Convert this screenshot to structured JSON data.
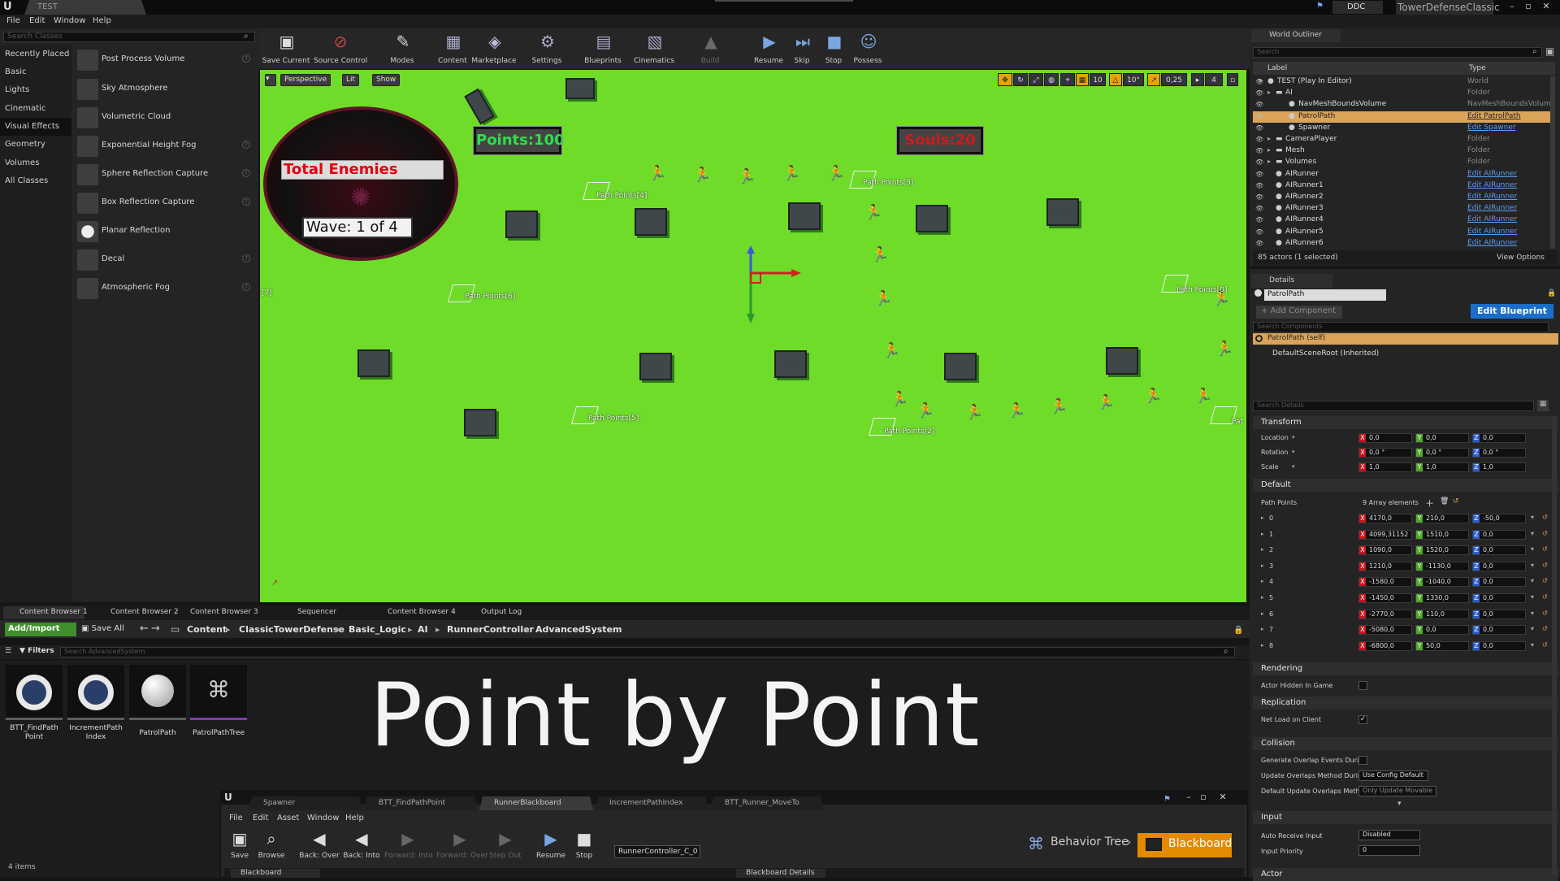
{
  "window": {
    "project_tab": "TEST",
    "ddc": "DDC",
    "project_name": "TowerDefenseClassic"
  },
  "menu": [
    "File",
    "Edit",
    "Window",
    "Help"
  ],
  "place": {
    "search_placeholder": "Search Classes",
    "categories": [
      "Recently Placed",
      "Basic",
      "Lights",
      "Cinematic",
      "Visual Effects",
      "Geometry",
      "Volumes",
      "All Classes"
    ],
    "selected_category": "Visual Effects",
    "items": [
      "Post Process Volume",
      "Sky Atmosphere",
      "Volumetric Cloud",
      "Exponential Height Fog",
      "Sphere Reflection Capture",
      "Box Reflection Capture",
      "Planar Reflection",
      "Decal",
      "Atmospheric Fog"
    ]
  },
  "toolbar": {
    "buttons": [
      "Save Current",
      "Source Control",
      "Modes",
      "Content",
      "Marketplace",
      "Settings",
      "Blueprints",
      "Cinematics",
      "Build",
      "Resume",
      "Skip",
      "Stop",
      "Possess"
    ],
    "disabled": [
      "Build"
    ]
  },
  "viewport": {
    "buttons": [
      "Perspective",
      "Lit",
      "Show"
    ],
    "readouts": [
      "10",
      "10°",
      "0,25",
      "4"
    ],
    "hud": {
      "total_enemies": "Total Enemies",
      "wave": "Wave: 1 of 4",
      "points": "Points:100",
      "souls": "Souls:20"
    },
    "path_labels": [
      "Path Points[4]",
      "Path Points[3]",
      "Path Points[6]",
      "Path Points[0]",
      "Path Points[5]",
      "Path Points[2]",
      "[7]",
      "Pat"
    ],
    "accent": "#6fdc2a"
  },
  "outliner": {
    "tab": "World Outliner",
    "search_placeholder": "Search",
    "col_label": "Label",
    "col_type": "Type",
    "rows": [
      {
        "label": "TEST (Play In Editor)",
        "type": "World",
        "link": false
      },
      {
        "label": "AI",
        "type": "Folder",
        "link": false
      },
      {
        "label": "NavMeshBoundsVolume",
        "type": "NavMeshBoundsVolume",
        "link": false
      },
      {
        "label": "PatrolPath",
        "type": "Edit PatrolPath",
        "link": true
      },
      {
        "label": "Spawner",
        "type": "Edit Spawner",
        "link": true
      },
      {
        "label": "CameraPlayer",
        "type": "Folder",
        "link": false
      },
      {
        "label": "Mesh",
        "type": "Folder",
        "link": false
      },
      {
        "label": "Volumes",
        "type": "Folder",
        "link": false
      },
      {
        "label": "AIRunner",
        "type": "Edit AIRunner",
        "link": true
      },
      {
        "label": "AIRunner1",
        "type": "Edit AIRunner",
        "link": true
      },
      {
        "label": "AIRunner2",
        "type": "Edit AIRunner",
        "link": true
      },
      {
        "label": "AIRunner3",
        "type": "Edit AIRunner",
        "link": true
      },
      {
        "label": "AIRunner4",
        "type": "Edit AIRunner",
        "link": true
      },
      {
        "label": "AIRunner5",
        "type": "Edit AIRunner",
        "link": true
      },
      {
        "label": "AIRunner6",
        "type": "Edit AIRunner",
        "link": true
      }
    ],
    "selected": "PatrolPath",
    "footer": "85 actors (1 selected)",
    "view_options": "View Options"
  },
  "details": {
    "tab": "Details",
    "name": "PatrolPath",
    "add_component": "+ Add Component",
    "edit_blueprint": "Edit Blueprint",
    "search_components": "Search Components",
    "self_row": "PatrolPath (self)",
    "root_row": "DefaultSceneRoot (Inherited)",
    "search_details": "Search Details",
    "sections": [
      "Transform",
      "Default",
      "Rendering",
      "Replication",
      "Collision",
      "Input",
      "Actor"
    ],
    "transform": [
      {
        "label": "Location",
        "x": "0,0",
        "y": "0,0",
        "z": "0,0"
      },
      {
        "label": "Rotation",
        "x": "0,0 °",
        "y": "0,0 °",
        "z": "0,0 °"
      },
      {
        "label": "Scale",
        "x": "1,0",
        "y": "1,0",
        "z": "1,0"
      }
    ],
    "path_points_label": "Path Points",
    "path_points_count": "9 Array elements",
    "path_points": [
      {
        "i": "0",
        "x": "4170,0",
        "y": "210,0",
        "z": "-50,0"
      },
      {
        "i": "1",
        "x": "4099,31152",
        "y": "1510,0",
        "z": "0,0"
      },
      {
        "i": "2",
        "x": "1090,0",
        "y": "1520,0",
        "z": "0,0"
      },
      {
        "i": "3",
        "x": "1210,0",
        "y": "-1130,0",
        "z": "0,0"
      },
      {
        "i": "4",
        "x": "-1580,0",
        "y": "-1040,0",
        "z": "0,0"
      },
      {
        "i": "5",
        "x": "-1450,0",
        "y": "1330,0",
        "z": "0,0"
      },
      {
        "i": "6",
        "x": "-2770,0",
        "y": "110,0",
        "z": "0,0"
      },
      {
        "i": "7",
        "x": "-5080,0",
        "y": "0,0",
        "z": "0,0"
      },
      {
        "i": "8",
        "x": "-6800,0",
        "y": "50,0",
        "z": "0,0"
      }
    ],
    "rendering": {
      "label": "Actor Hidden In Game"
    },
    "replication": {
      "label": "Net Load on Client"
    },
    "collision": [
      {
        "label": "Generate Overlap Events During"
      },
      {
        "label": "Update Overlaps Method During",
        "value": "Use Config Default"
      },
      {
        "label": "Default Update Overlaps Metho",
        "value": "Only Update Movable"
      }
    ],
    "input": [
      {
        "label": "Auto Receive Input",
        "value": "Disabled"
      },
      {
        "label": "Input Priority",
        "value": "0"
      }
    ]
  },
  "content_browser": {
    "tabs": [
      "Content Browser 1",
      "Content Browser 2",
      "Content Browser 3",
      "Sequencer",
      "Content Browser 4",
      "Output Log"
    ],
    "add_import": "Add/Import",
    "save_all": "Save All",
    "path": [
      "Content",
      "ClassicTowerDefense",
      "Basic_Logic",
      "AI",
      "RunnerController",
      "AdvancedSystem"
    ],
    "filters": "Filters",
    "search_placeholder": "Search AdvancedSystem",
    "assets": [
      "BTT_FindPath Point",
      "IncrementPath Index",
      "PatrolPath",
      "PatrolPathTree"
    ],
    "items": "4 items"
  },
  "overlay_title": "Point by Point",
  "bt_editor": {
    "tabs": [
      "Spawner",
      "BTT_FindPathPoint",
      "RunnerBlackboard",
      "IncrementPathIndex",
      "BTT_Runner_MoveTo"
    ],
    "menu": [
      "File",
      "Edit",
      "Asset",
      "Window",
      "Help"
    ],
    "buttons": [
      "Save",
      "Browse",
      "Back: Over",
      "Back: Into",
      "Forward: Into",
      "Forward: Over",
      "Step Out",
      "Resume",
      "Stop"
    ],
    "controller": "RunnerController_C_0",
    "mode_bt": "Behavior Tree",
    "mode_bb": "Blackboard",
    "footer_left": "Blackboard",
    "footer_right": "Blackboard Details"
  }
}
